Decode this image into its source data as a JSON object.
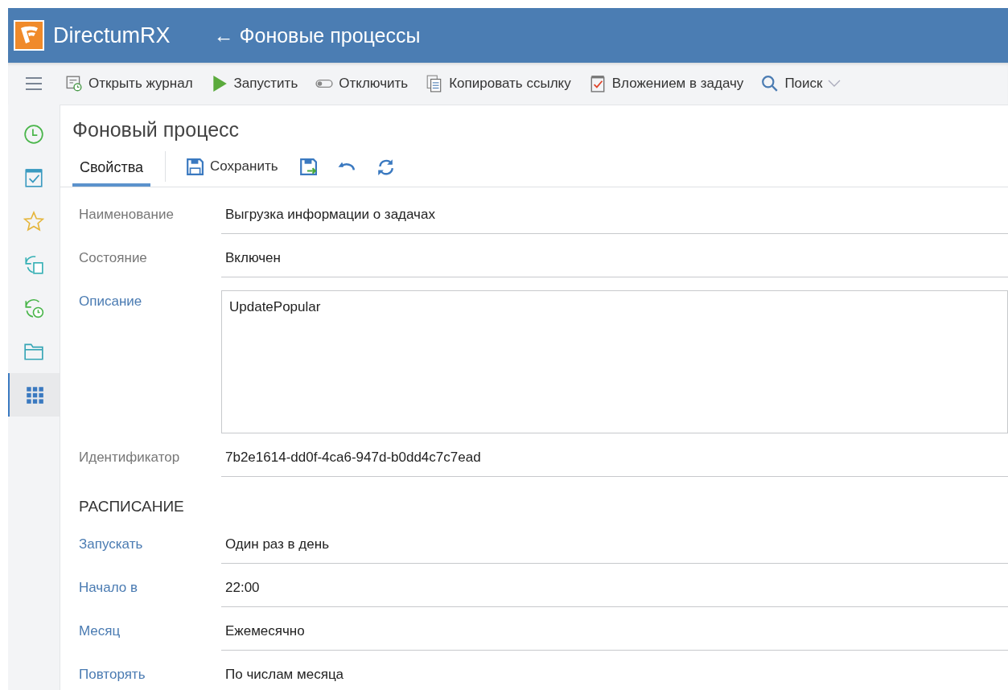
{
  "header": {
    "app_name": "DirectumRX",
    "back_title": "← Фоновые процессы"
  },
  "toolbar": [
    {
      "label": "Открыть журнал",
      "kind": "journal"
    },
    {
      "label": "Запустить",
      "kind": "play"
    },
    {
      "label": "Отключить",
      "kind": "toggle"
    },
    {
      "label": "Копировать ссылку",
      "kind": "copy"
    },
    {
      "label": "Вложением в задачу",
      "kind": "attach"
    },
    {
      "label": "Поиск",
      "kind": "search",
      "dropdown": true
    }
  ],
  "sidebar": {
    "items": [
      {
        "kind": "clock",
        "selected": false
      },
      {
        "kind": "calendar",
        "selected": false
      },
      {
        "kind": "star",
        "selected": false
      },
      {
        "kind": "doc-refresh",
        "selected": false
      },
      {
        "kind": "clock-refresh",
        "selected": false
      },
      {
        "kind": "folder",
        "selected": false
      },
      {
        "kind": "grid",
        "selected": true
      }
    ]
  },
  "card": {
    "title": "Фоновый процесс",
    "tabs": [
      {
        "label": "Свойства",
        "selected": true
      }
    ],
    "actions": [
      {
        "kind": "save",
        "label": "Сохранить"
      },
      {
        "kind": "save-close"
      },
      {
        "kind": "undo"
      },
      {
        "kind": "refresh"
      }
    ],
    "fields": [
      {
        "label": "Наименование",
        "value": "Выгрузка информации о задачах",
        "readonly": true,
        "kind": "text"
      },
      {
        "label": "Состояние",
        "value": "Включен",
        "readonly": true,
        "kind": "text"
      },
      {
        "label": "Описание",
        "value": "UpdatePopular",
        "readonly": false,
        "kind": "textarea"
      },
      {
        "label": "Идентификатор",
        "value": "7b2e1614-dd0f-4ca6-947d-b0dd4c7c7ead",
        "readonly": true,
        "kind": "text"
      }
    ],
    "section": {
      "title": "РАСПИСАНИЕ",
      "fields": [
        {
          "label": "Запускать",
          "value": "Один раз в день",
          "readonly": false,
          "kind": "text"
        },
        {
          "label": "Начало в",
          "value": "22:00",
          "readonly": false,
          "kind": "text"
        },
        {
          "label": "Месяц",
          "value": "Ежемесячно",
          "readonly": false,
          "kind": "text"
        },
        {
          "label": "Повторять",
          "value": "По числам месяца",
          "readonly": false,
          "kind": "split"
        }
      ]
    }
  }
}
